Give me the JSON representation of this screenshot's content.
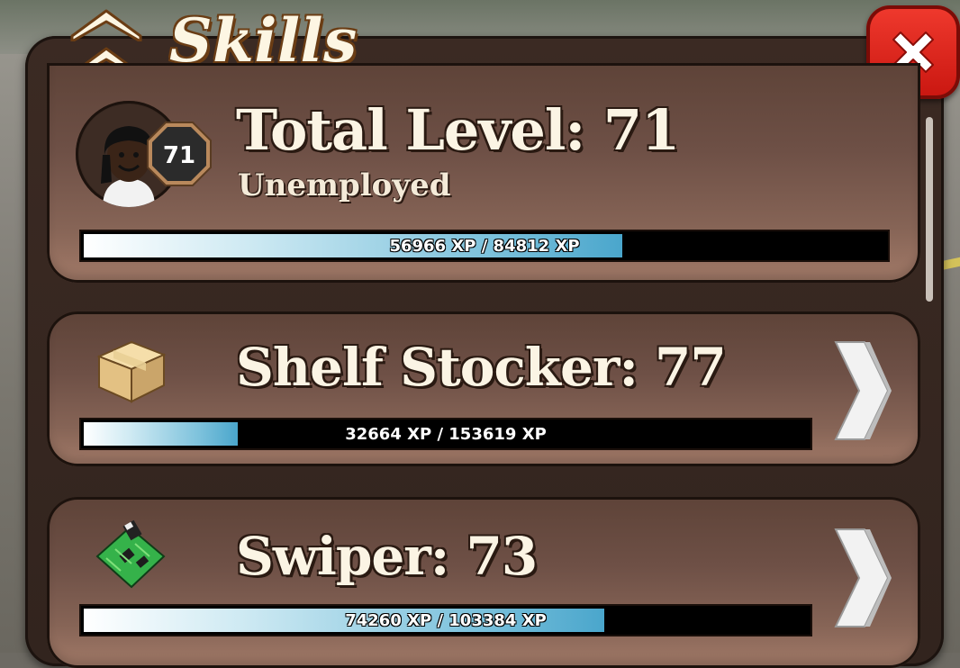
{
  "window": {
    "title": "Skills"
  },
  "close_button": {
    "icon": "close-icon",
    "color": "#e0241b"
  },
  "total": {
    "label": "Total Level: 71",
    "job": "Unemployed",
    "badge_level": "71",
    "xp_text": "56966 XP / 84812 XP",
    "progress": 0.6717
  },
  "skills": [
    {
      "label": "Shelf Stocker: 77",
      "icon": "cardboard-box-icon",
      "xp_text": "32664 XP / 153619 XP",
      "progress": 0.2126
    },
    {
      "label": "Swiper: 73",
      "icon": "circuit-board-icon",
      "xp_text": "74260 XP / 103384 XP",
      "progress": 0.7183
    }
  ],
  "colors": {
    "panel": "#32241e",
    "card": "#7a5a4c",
    "bar_fill": "#4aa6cc",
    "text": "#fbf4e4"
  }
}
